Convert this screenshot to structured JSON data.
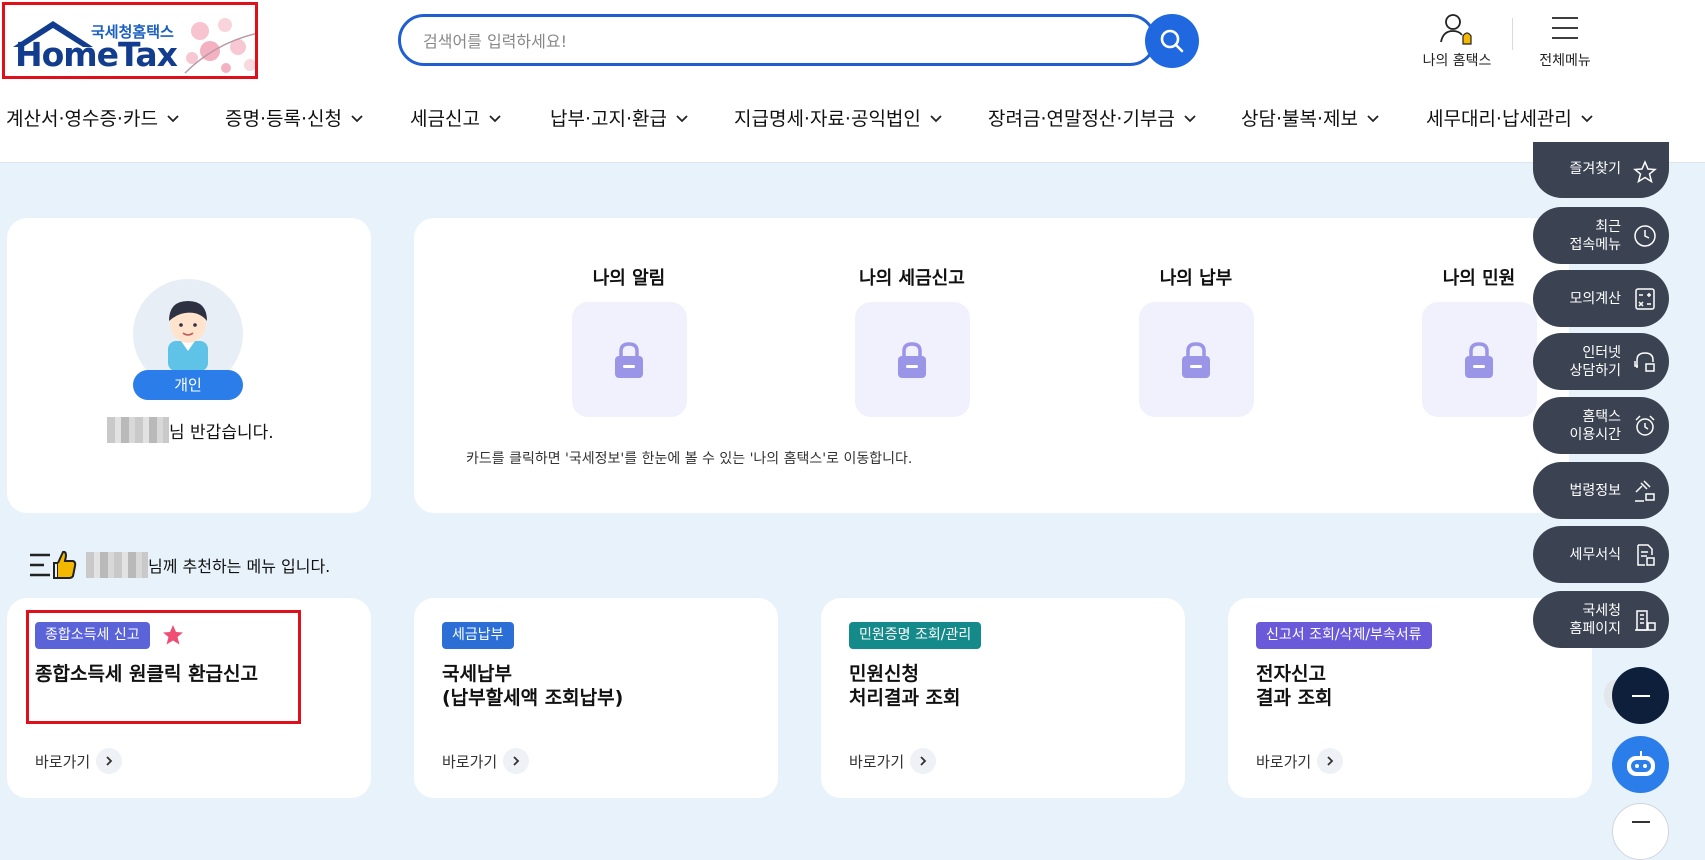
{
  "logo": {
    "sub": "국세청홈택스",
    "main": "HomeTax"
  },
  "search": {
    "placeholder": "검색어를 입력하세요!"
  },
  "top_icons": {
    "my_hometax": "나의 홈택스",
    "all_menu": "전체메뉴"
  },
  "nav": [
    "계산서·영수증·카드",
    "증명·등록·신청",
    "세금신고",
    "납부·고지·환급",
    "지급명세·자료·공익법인",
    "장려금·연말정산·기부금",
    "상담·불복·제보",
    "세무대리·납세관리"
  ],
  "profile": {
    "badge": "개인",
    "greeting_suffix": "님 반갑습니다."
  },
  "my_section": {
    "items": [
      "나의 알림",
      "나의 세금신고",
      "나의 납부",
      "나의 민원"
    ],
    "note": "카드를 클릭하면 '국세정보'를 한눈에 볼 수 있는 '나의 홈택스'로 이동합니다."
  },
  "recommend": {
    "suffix": "님께 추천하는 메뉴 입니다."
  },
  "menu_cards": [
    {
      "tag": "종합소득세 신고",
      "tag_color": "#5b63d9",
      "title": "종합소득세 원클릭 환급신고",
      "goto": "바로가기"
    },
    {
      "tag": "세금납부",
      "tag_color": "#2b6fd6",
      "title": "국세납부\n(납부할세액 조회납부)",
      "goto": "바로가기"
    },
    {
      "tag": "민원증명 조회/관리",
      "tag_color": "#148a8a",
      "title": "민원신청\n처리결과 조회",
      "goto": "바로가기"
    },
    {
      "tag": "신고서 조회/삭제/부속서류",
      "tag_color": "#6a5ad9",
      "title": "전자신고\n결과 조회",
      "goto": "바로가기"
    }
  ],
  "quick_menu": [
    {
      "label": "즐겨찾기",
      "icon": "star-icon"
    },
    {
      "label": "최근\n접속메뉴",
      "icon": "clock-icon"
    },
    {
      "label": "모의계산",
      "icon": "calculator-icon"
    },
    {
      "label": "인터넷\n상담하기",
      "icon": "chat-icon"
    },
    {
      "label": "홈택스\n이용시간",
      "icon": "alarm-icon"
    },
    {
      "label": "법령정보",
      "icon": "gavel-icon"
    },
    {
      "label": "세무서식",
      "icon": "document-icon"
    },
    {
      "label": "국세청\n홈페이지",
      "icon": "building-icon"
    }
  ]
}
